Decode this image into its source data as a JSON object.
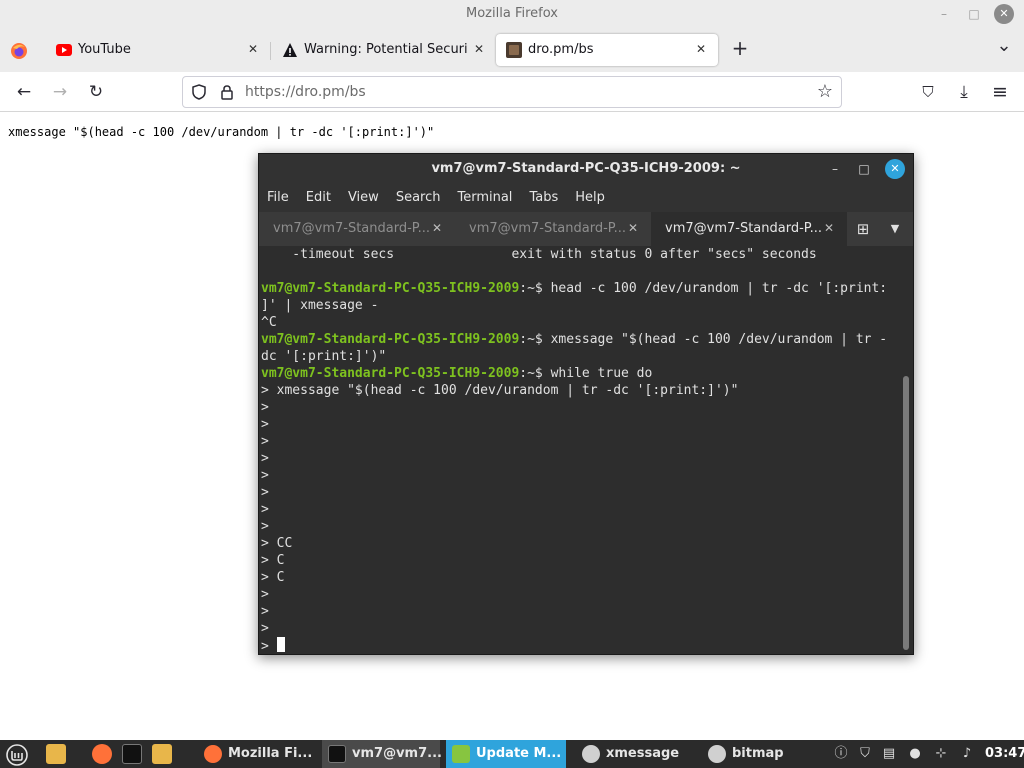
{
  "window": {
    "title": "Mozilla Firefox",
    "minimize_glyph": "–",
    "maximize_glyph": "□",
    "close_glyph": "✕"
  },
  "tabs": [
    {
      "label": "YouTube",
      "icon": "youtube-icon",
      "active": false
    },
    {
      "label": "Warning: Potential Security",
      "icon": "warning-icon",
      "active": false
    },
    {
      "label": "dro.pm/bs",
      "icon": "page-favicon",
      "active": true
    }
  ],
  "tab_close_glyph": "✕",
  "new_tab_glyph": "+",
  "tab_list_glyph": "⌄",
  "navbar": {
    "back_glyph": "←",
    "forward_glyph": "→",
    "reload_glyph": "↻",
    "url_host": "https://dro.pm",
    "url_path": "/bs",
    "bookmark_glyph": "☆",
    "pocket_glyph": "⛉",
    "downloads_glyph": "⤓",
    "menu_glyph": "≡"
  },
  "page": {
    "text": "xmessage \"$(head -c 100 /dev/urandom | tr -dc '[:print:]')\""
  },
  "terminal": {
    "title": "vm7@vm7-Standard-PC-Q35-ICH9-2009: ~",
    "minimize_glyph": "–",
    "maximize_glyph": "□",
    "close_glyph": "✕",
    "menus": [
      "File",
      "Edit",
      "View",
      "Search",
      "Terminal",
      "Tabs",
      "Help"
    ],
    "tabs": [
      {
        "label": "vm7@vm7-Standard-P...",
        "active": false
      },
      {
        "label": "vm7@vm7-Standard-P...",
        "active": false
      },
      {
        "label": "vm7@vm7-Standard-P...",
        "active": true
      }
    ],
    "tab_close_glyph": "✕",
    "new_tab_glyph": "⊞",
    "tab_menu_glyph": "▼",
    "lines": [
      {
        "host": "",
        "text": "    -timeout secs               exit with status 0 after \"secs\" seconds"
      },
      {
        "host": "",
        "text": ""
      },
      {
        "host": "vm7@vm7-Standard-PC-Q35-ICH9-2009",
        "text": ":~$ head -c 100 /dev/urandom | tr -dc '[:print:"
      },
      {
        "host": "",
        "text": "]' | xmessage -"
      },
      {
        "host": "",
        "text": "^C"
      },
      {
        "host": "vm7@vm7-Standard-PC-Q35-ICH9-2009",
        "text": ":~$ xmessage \"$(head -c 100 /dev/urandom | tr -"
      },
      {
        "host": "",
        "text": "dc '[:print:]')\""
      },
      {
        "host": "vm7@vm7-Standard-PC-Q35-ICH9-2009",
        "text": ":~$ while true do"
      },
      {
        "host": "",
        "text": "> xmessage \"$(head -c 100 /dev/urandom | tr -dc '[:print:]')\""
      },
      {
        "host": "",
        "text": ">"
      },
      {
        "host": "",
        "text": ">"
      },
      {
        "host": "",
        "text": ">"
      },
      {
        "host": "",
        "text": ">"
      },
      {
        "host": "",
        "text": ">"
      },
      {
        "host": "",
        "text": ">"
      },
      {
        "host": "",
        "text": ">"
      },
      {
        "host": "",
        "text": ">"
      },
      {
        "host": "",
        "text": "> CC"
      },
      {
        "host": "",
        "text": "> C"
      },
      {
        "host": "",
        "text": "> C"
      },
      {
        "host": "",
        "text": ">"
      },
      {
        "host": "",
        "text": ">"
      },
      {
        "host": "",
        "text": ">"
      }
    ],
    "cursor_line": "> "
  },
  "taskbar": {
    "items": [
      {
        "label": "Mozilla Fi...",
        "icon": "firefox-icon",
        "active": false
      },
      {
        "label": "vm7@vm7...",
        "icon": "terminal-icon",
        "active": true
      },
      {
        "label": "Update M...",
        "icon": "shield-icon",
        "active": false
      },
      {
        "label": "xmessage",
        "icon": "gear-icon",
        "active": false
      },
      {
        "label": "bitmap",
        "icon": "gear-icon",
        "active": false
      }
    ],
    "clock": "03:47",
    "colors": {
      "accent": "#2fa4dc",
      "prompt": "#7ec21f",
      "mint": "#87c540",
      "firefox": "#ff7139"
    }
  }
}
